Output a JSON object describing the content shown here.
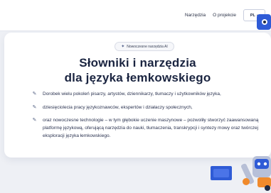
{
  "nav": {
    "links": [
      "Narzędzia",
      "O projekcie"
    ],
    "language": {
      "selected": "PL",
      "icon": "chevron-down-icon"
    }
  },
  "hero": {
    "badge": {
      "label": "Nowoczesne narzędzia AI",
      "icon": "sparkle-icon"
    },
    "title_line1": "Słowniki i narzędzia",
    "title_line2": "dla języka łemkowskiego",
    "bullets": [
      {
        "icon": "feather-icon",
        "text": "Dorobek wielu pokoleń pisarzy, artystów, dziennikarzy, tłumaczy i użytkowników języka,"
      },
      {
        "icon": "feather-icon",
        "text": "dziesięciolecia pracy językoznawców, ekspertów i działaczy społecznych,"
      },
      {
        "icon": "feather-icon",
        "text": "oraz nowoczesne technologie – w tym głębokie uczenie maszynowe – pozwoliły stworzyć zaawansowaną platformę językową, oferującą narzędzia do nauki, tłumaczenia, transkrypcji i syntezy mowy oraz twórczej eksploracji języka łemkowskiego."
      }
    ]
  },
  "colors": {
    "accent": "#3b4f86",
    "robot_blue": "#2f5bd6",
    "robot_orange": "#f08a2c"
  }
}
